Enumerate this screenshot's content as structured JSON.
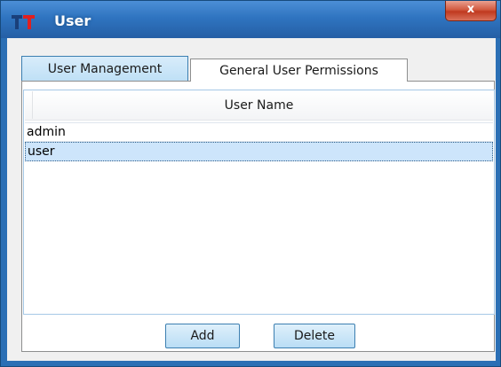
{
  "window": {
    "title": "User",
    "close_label": "x",
    "app_icon": "tt-logo-icon",
    "colors": {
      "titlebar": "#2f74c0",
      "close_button": "#c0391f",
      "selection": "#cde5fb",
      "button": "#b9ddf5"
    }
  },
  "tabs": [
    {
      "label": "User Management",
      "active": true
    },
    {
      "label": "General User Permissions",
      "active": false
    }
  ],
  "table": {
    "columns": [
      "User Name"
    ],
    "rows": [
      {
        "user_name": "admin",
        "selected": false
      },
      {
        "user_name": "user",
        "selected": true
      }
    ]
  },
  "buttons": {
    "add_label": "Add",
    "delete_label": "Delete"
  }
}
